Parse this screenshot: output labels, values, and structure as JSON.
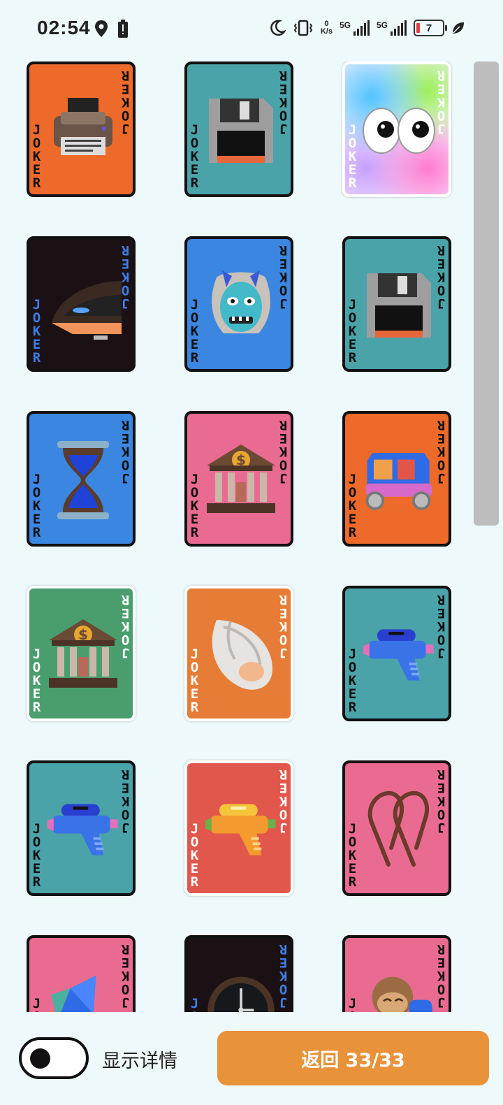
{
  "status_bar": {
    "time": "02:54",
    "net_speed_top": "0",
    "net_speed_bottom": "K/s",
    "sim1_label": "5G",
    "sim2_label": "5G",
    "battery_level": "7"
  },
  "cards": {
    "joker_text": "JOKER",
    "items": [
      {
        "icon": "printer-icon",
        "bg": "#ee6a2a",
        "ink": "#111"
      },
      {
        "icon": "floppy-disk-icon",
        "bg": "#4aa3a9",
        "ink": "#111"
      },
      {
        "icon": "googly-eyes-icon",
        "bg": "rainbow",
        "ink": "#ffffff"
      },
      {
        "icon": "bullet-train-icon",
        "bg": "#1b1115",
        "ink": "#3e7de6"
      },
      {
        "icon": "ogre-mask-icon",
        "bg": "#3b86e0",
        "ink": "#111"
      },
      {
        "icon": "floppy-disk-icon",
        "bg": "#4aa3a9",
        "ink": "#111"
      },
      {
        "icon": "hourglass-icon",
        "bg": "#3b86e0",
        "ink": "#111"
      },
      {
        "icon": "bank-icon",
        "bg": "#ea6b92",
        "ink": "#111"
      },
      {
        "icon": "auto-rickshaw-icon",
        "bg": "#ee6a2a",
        "ink": "#111"
      },
      {
        "icon": "bank-icon",
        "bg": "#4a9e6e",
        "ink": "#ffffff"
      },
      {
        "icon": "spiral-shell-icon",
        "bg": "#e67c35",
        "ink": "#ffffff"
      },
      {
        "icon": "water-pistol-icon",
        "bg": "#4aa3a9",
        "ink": "#111"
      },
      {
        "icon": "water-pistol-icon",
        "bg": "#4aa3a9",
        "ink": "#111"
      },
      {
        "icon": "water-pistol-orange-icon",
        "bg": "#e2574c",
        "ink": "#ffffff"
      },
      {
        "icon": "linked-paperclips-icon",
        "bg": "#ea6b92",
        "ink": "#111"
      },
      {
        "icon": "kite-icon",
        "bg": "#ea6b92",
        "ink": "#111"
      },
      {
        "icon": "clock-icon",
        "bg": "#1b1115",
        "ink": "#3e7de6"
      },
      {
        "icon": "monkey-icon",
        "bg": "#ea6b92",
        "ink": "#111"
      }
    ]
  },
  "footer": {
    "toggle_label": "显示详情",
    "return_button": "返回 33/33",
    "toggle_on": false
  },
  "colors": {
    "background": "#eef9fb",
    "accent": "#e8923a"
  }
}
